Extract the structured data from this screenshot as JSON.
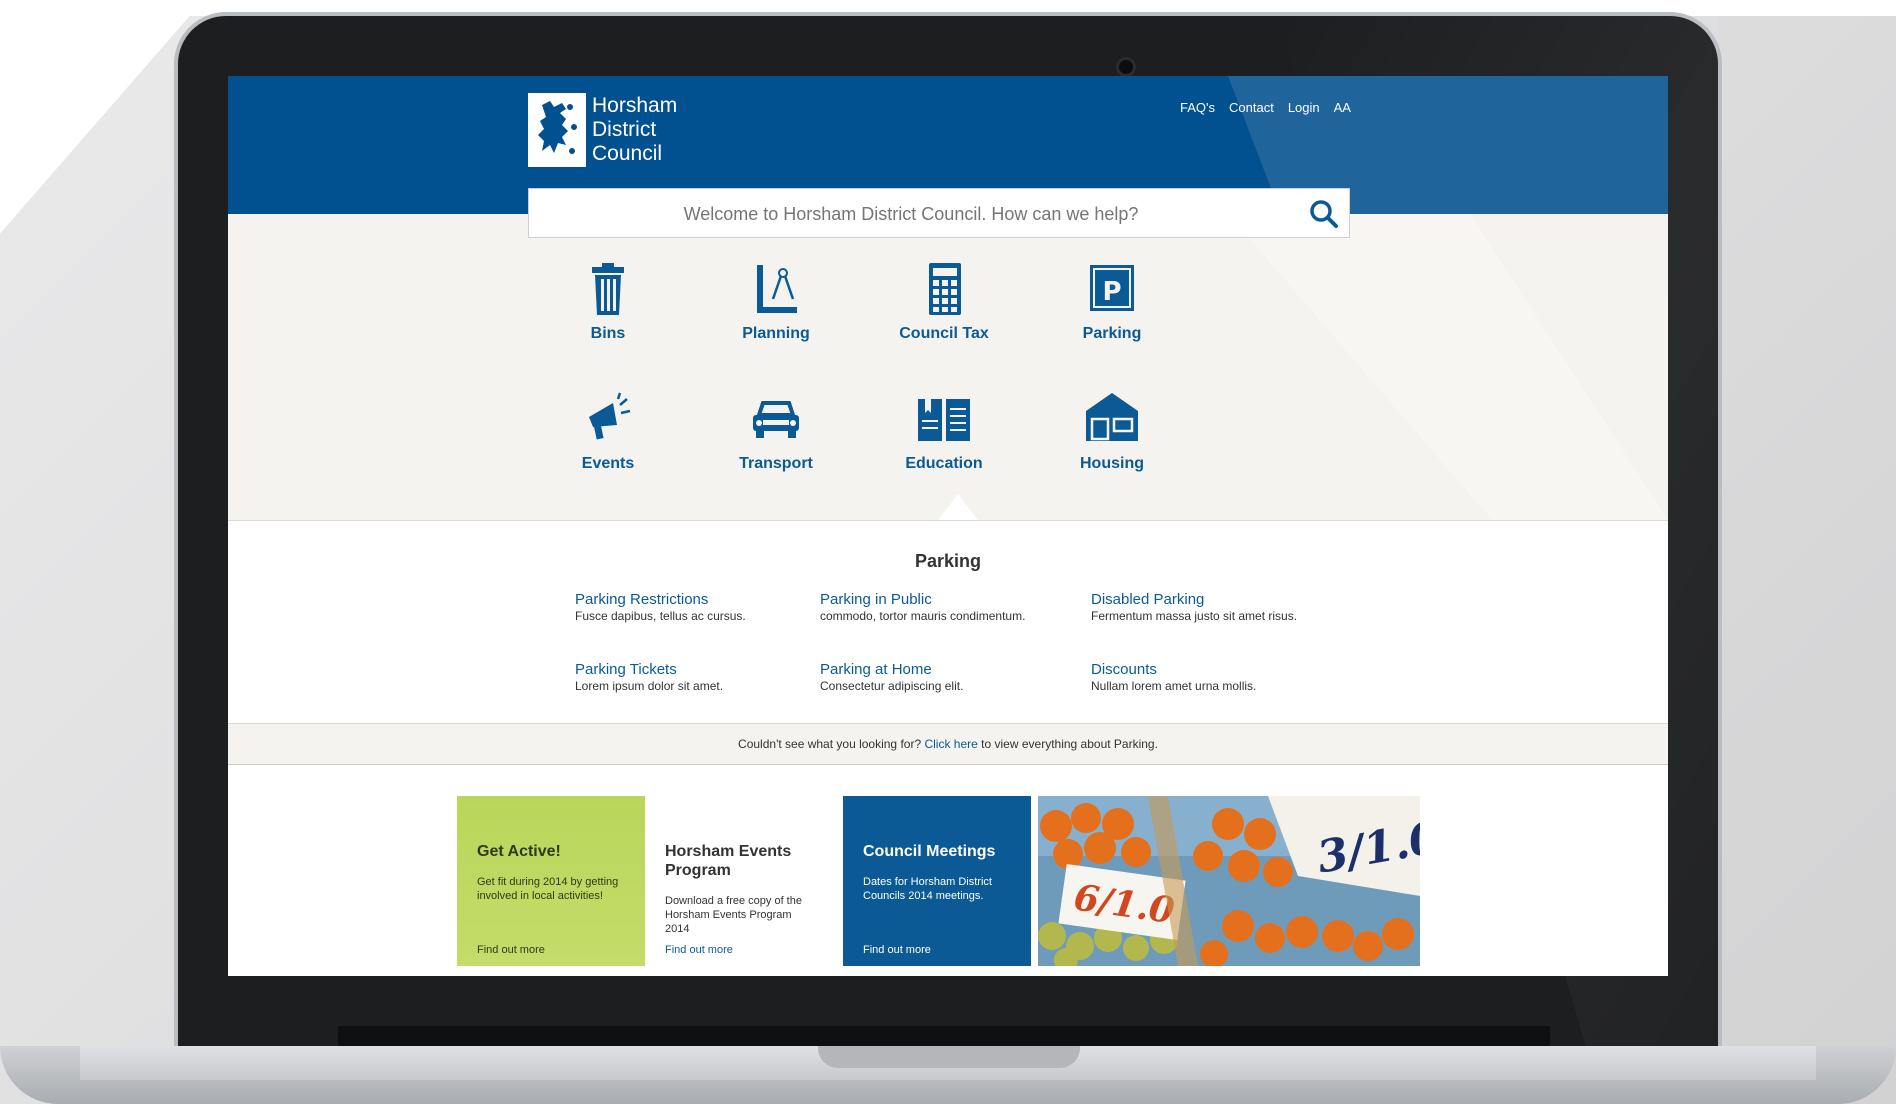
{
  "brand": {
    "name_lines": [
      "Horsham",
      "District",
      "Council"
    ],
    "primary_color": "#01508f",
    "link_color": "#0b5a96",
    "logo_icon": "lion-crest-icon"
  },
  "topnav": {
    "items": [
      "FAQ's",
      "Contact",
      "Login",
      "AA"
    ]
  },
  "search": {
    "placeholder": "Welcome to Horsham District Council. How can we help?",
    "icon": "search-icon"
  },
  "services": [
    {
      "label": "Bins",
      "icon": "bin-icon"
    },
    {
      "label": "Planning",
      "icon": "compass-icon"
    },
    {
      "label": "Council Tax",
      "icon": "calculator-icon"
    },
    {
      "label": "Parking",
      "icon": "parking-icon"
    },
    {
      "label": "Events",
      "icon": "megaphone-icon"
    },
    {
      "label": "Transport",
      "icon": "car-icon"
    },
    {
      "label": "Education",
      "icon": "book-icon"
    },
    {
      "label": "Housing",
      "icon": "house-icon"
    }
  ],
  "panel": {
    "title": "Parking",
    "links": [
      {
        "title": "Parking Restrictions",
        "desc": "Fusce dapibus, tellus ac cursus."
      },
      {
        "title": "Parking in Public",
        "desc": "commodo, tortor mauris condimentum."
      },
      {
        "title": "Disabled Parking",
        "desc": "Fermentum massa justo sit amet risus."
      },
      {
        "title": "Parking Tickets",
        "desc": "Lorem ipsum dolor sit amet."
      },
      {
        "title": "Parking at Home",
        "desc": "Consectetur adipiscing elit."
      },
      {
        "title": "Discounts",
        "desc": "Nullam lorem amet urna mollis."
      }
    ]
  },
  "footer_strip": {
    "prefix": "Couldn't see what you looking for?",
    "link": "Click here",
    "suffix": "to view everything about Parking."
  },
  "cards": [
    {
      "title": "Get Active!",
      "text": "Get fit during 2014 by getting involved in local activities!",
      "link": "Find out more"
    },
    {
      "title": "Horsham Events Program",
      "text": "Download a free copy of the Horsham Events Program 2014",
      "link": "Find out more"
    },
    {
      "title": "Council Meetings",
      "text": "Dates for Horsham District Councils 2014 meetings.",
      "link": "Find out more"
    }
  ]
}
